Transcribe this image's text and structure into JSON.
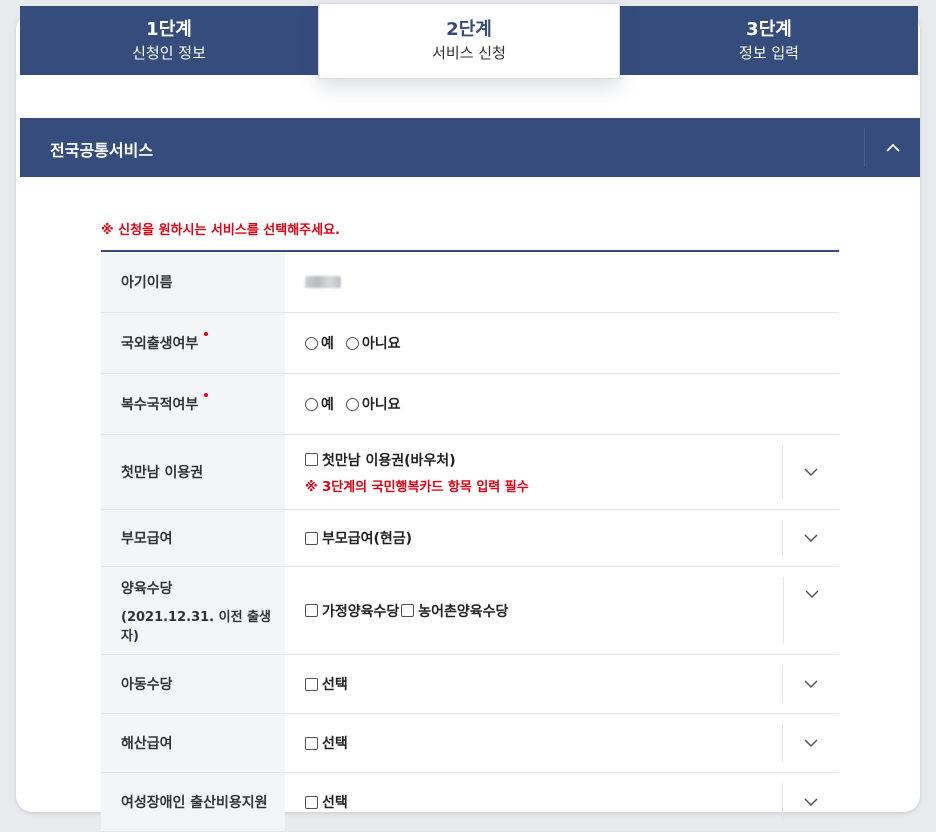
{
  "steps": [
    {
      "num": "1단계",
      "name": "신청인 정보",
      "active": false
    },
    {
      "num": "2단계",
      "name": "서비스 신청",
      "active": true
    },
    {
      "num": "3단계",
      "name": "정보 입력",
      "active": false
    }
  ],
  "section": {
    "title": "전국공통서비스",
    "notice": "※ 신청을 원하시는 서비스를 선택해주세요."
  },
  "rows": {
    "baby_name": {
      "label": "아기이름"
    },
    "foreign_birth": {
      "label": "국외출생여부",
      "yes": "예",
      "no": "아니요"
    },
    "dual_nationality": {
      "label": "복수국적여부",
      "yes": "예",
      "no": "아니요"
    },
    "first_meeting": {
      "label": "첫만남 이용권",
      "option": "첫만남 이용권(바우처)",
      "note": "※ 3단계의 국민행복카드 항목 입력 필수"
    },
    "parent_pay": {
      "label": "부모급여",
      "option": "부모급여(현금)"
    },
    "childcare": {
      "label": "양육수당",
      "label_sub": "(2021.12.31. 이전 출생자)",
      "option1": "가정양육수당",
      "option2": "농어촌양육수당"
    },
    "child_allowance": {
      "label": "아동수당",
      "option": "선택"
    },
    "maternity_pay": {
      "label": "해산급여",
      "option": "선택"
    },
    "disabled_women": {
      "label": "여성장애인 출산비용지원",
      "option": "선택"
    }
  },
  "colors": {
    "navy": "#354c7c",
    "red": "#e60012"
  }
}
